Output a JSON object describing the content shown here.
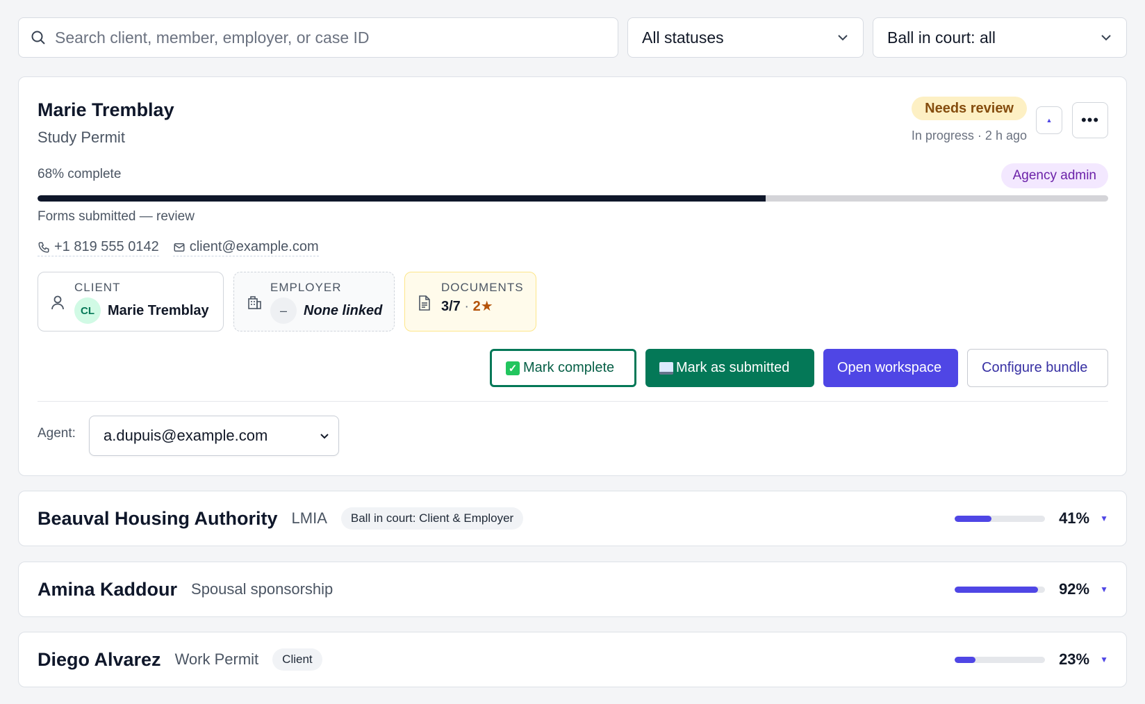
{
  "filters": {
    "search_placeholder": "Search client, member, employer, or case ID",
    "status_value": "All statuses",
    "ball_value": "Ball in court: all"
  },
  "expanded_case": {
    "name": "Marie Tremblay",
    "program": "Study Permit",
    "status_badge": "Needs review",
    "meta": "In progress · 2 h ago",
    "percent_label": "68% complete",
    "progress": 0.68,
    "role_badge": "Agency admin",
    "stage": "Forms submitted — review",
    "phone": "+1 819 555 0142",
    "email": "client@example.com",
    "client_tile": {
      "label": "CLIENT",
      "initials": "CL",
      "name": "Marie Tremblay"
    },
    "employer_tile": {
      "label": "EMPLOYER",
      "placeholder": "–",
      "value": "None linked"
    },
    "documents_tile": {
      "label": "DOCUMENTS",
      "count": "3/7",
      "sep": "·",
      "starred": "2★"
    },
    "actions": {
      "mark_complete": "Mark complete",
      "mark_submitted": "Mark as submitted",
      "open_workspace": "Open workspace",
      "configure_bundle": "Configure bundle"
    },
    "agent_label": "Agent:",
    "agent_value": "a.dupuis@example.com"
  },
  "cases": [
    {
      "name": "Beauval Housing Authority",
      "program": "LMIA",
      "tag": "Ball in court: Client & Employer",
      "percent": "41%",
      "progress": 0.41
    },
    {
      "name": "Amina Kaddour",
      "program": "Spousal sponsorship",
      "tag": "",
      "percent": "92%",
      "progress": 0.92
    },
    {
      "name": "Diego Alvarez",
      "program": "Work Permit",
      "tag": "Client",
      "percent": "23%",
      "progress": 0.23
    }
  ],
  "colors": {
    "accent": "#4f46e5",
    "success": "#047857",
    "progress_dark": "#0f172a",
    "review_bg": "#fdf0c4"
  },
  "icons": [
    "search-icon",
    "chevron-down-icon",
    "phone-icon",
    "mail-icon",
    "user-icon",
    "building-icon",
    "document-icon",
    "check-icon",
    "tray-icon",
    "caret-up-icon",
    "more-icon",
    "caret-down-icon"
  ]
}
